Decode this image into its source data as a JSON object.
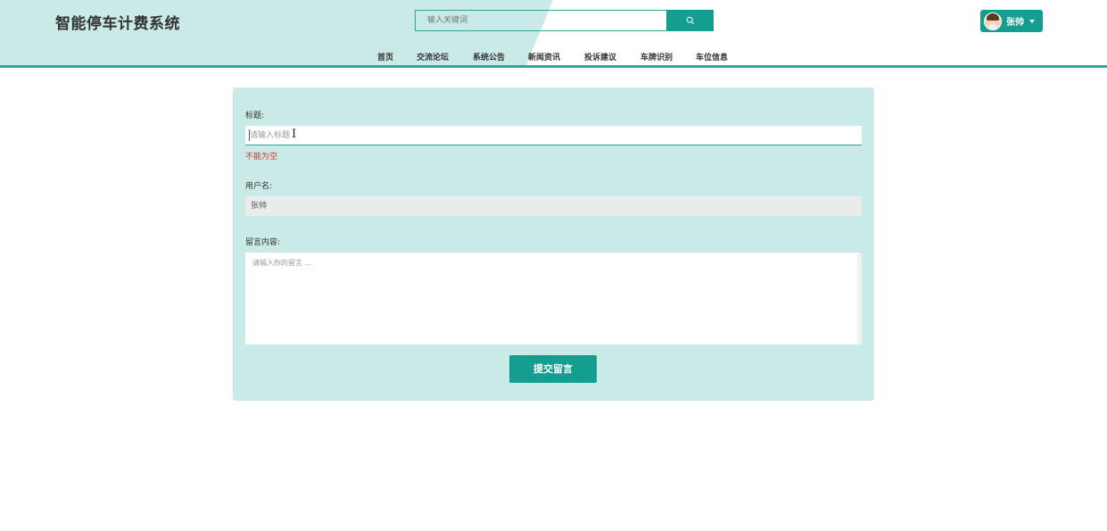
{
  "header": {
    "brand": "智能停车计费系统",
    "search_placeholder": "输入关键词",
    "search_icon": "search-icon",
    "user_name": "张帅",
    "user_menu_icon": "caret-down-icon"
  },
  "nav": {
    "items": [
      {
        "label": "首页"
      },
      {
        "label": "交流论坛"
      },
      {
        "label": "系统公告"
      },
      {
        "label": "新闻资讯"
      },
      {
        "label": "投诉建议"
      },
      {
        "label": "车牌识别"
      },
      {
        "label": "车位信息"
      }
    ]
  },
  "form": {
    "title_label": "标题:",
    "title_placeholder": "请输入标题",
    "title_error": "不能为空",
    "username_label": "用户名:",
    "username_value": "张帅",
    "content_label": "留言内容:",
    "content_placeholder": "请输入你的留言 ...",
    "submit_label": "提交留言"
  },
  "colors": {
    "accent": "#139e90",
    "header_tint": "#c9eae7",
    "panel": "#c9eae7",
    "error": "#cc3333"
  }
}
